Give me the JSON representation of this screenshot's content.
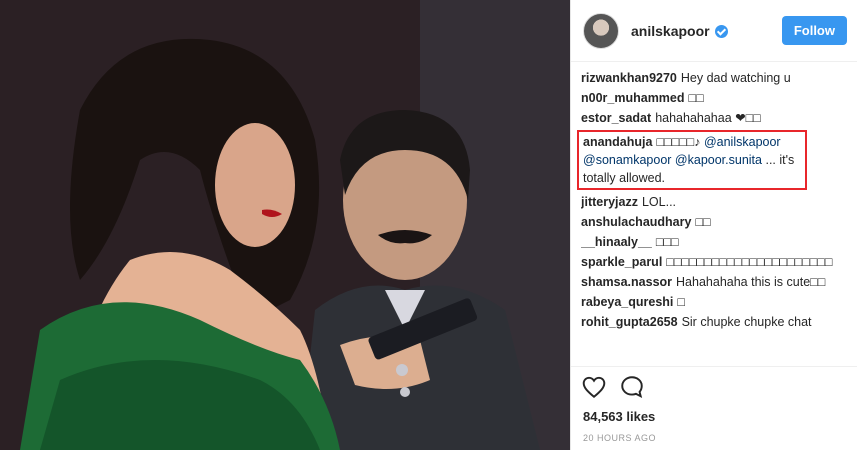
{
  "post": {
    "username": "anilskapoor",
    "follow_label": "Follow",
    "likes": "84,563 likes",
    "time": "20 HOURS AGO"
  },
  "comments": [
    {
      "user": "rizwankhan9270",
      "text": "Hey dad watching u"
    },
    {
      "user": "n00r_muhammed",
      "text": "□□"
    },
    {
      "user": "estor_sadat",
      "text": "hahahahahaa ❤□□"
    },
    {
      "user": "anandahuja",
      "text": "□□□□□♪",
      "m1": "@anilskapoor",
      "m2": "@sonamkapoor",
      "m3": "@kapoor.sunita",
      "tail": "... it's totally allowed."
    },
    {
      "user": "jitteryjazz",
      "text": "LOL..."
    },
    {
      "user": "anshulachaudhary",
      "text": "□□"
    },
    {
      "user": "__hinaaly__",
      "text": "□□□"
    },
    {
      "user": "sparkle_parul",
      "text": "□□□□□□□□□□□□□□□□□□□□□□"
    },
    {
      "user": "shamsa.nassor",
      "text": "Hahahahaha this is cute□□"
    },
    {
      "user": "rabeya_qureshi",
      "text": "□"
    },
    {
      "user": "rohit_gupta2658",
      "text": "Sir chupke chupke chat"
    }
  ],
  "icons": {
    "like": "heart-icon",
    "comment": "speech-bubble-icon",
    "verified": "verified-badge-icon"
  },
  "colors": {
    "follow_bg": "#3897f0",
    "highlight_border": "#e8262b",
    "mention": "#003569"
  }
}
